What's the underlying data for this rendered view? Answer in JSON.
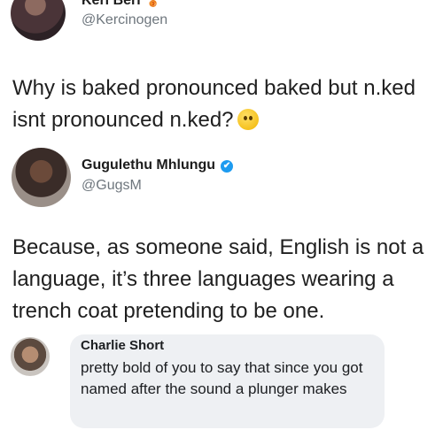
{
  "tweet1": {
    "name": "Keri Beri",
    "name_emoji": "🥉",
    "handle": "@Kercinogen",
    "text": "Why is baked pronounced baked but n.ked isnt pronounced n.ked?",
    "trailing_emoji_icon": "thinking-face-icon"
  },
  "tweet2": {
    "name": "Gugulethu Mhlungu",
    "verified_icon": "✔",
    "handle": "@GugsM",
    "text": "Because, as someone said, English is not a language, it’s three languages wearing a trench coat pretending to be one."
  },
  "comment": {
    "name": "Charlie Short",
    "text": "pretty bold of you to say that since you got named after the sound a plunger makes"
  }
}
